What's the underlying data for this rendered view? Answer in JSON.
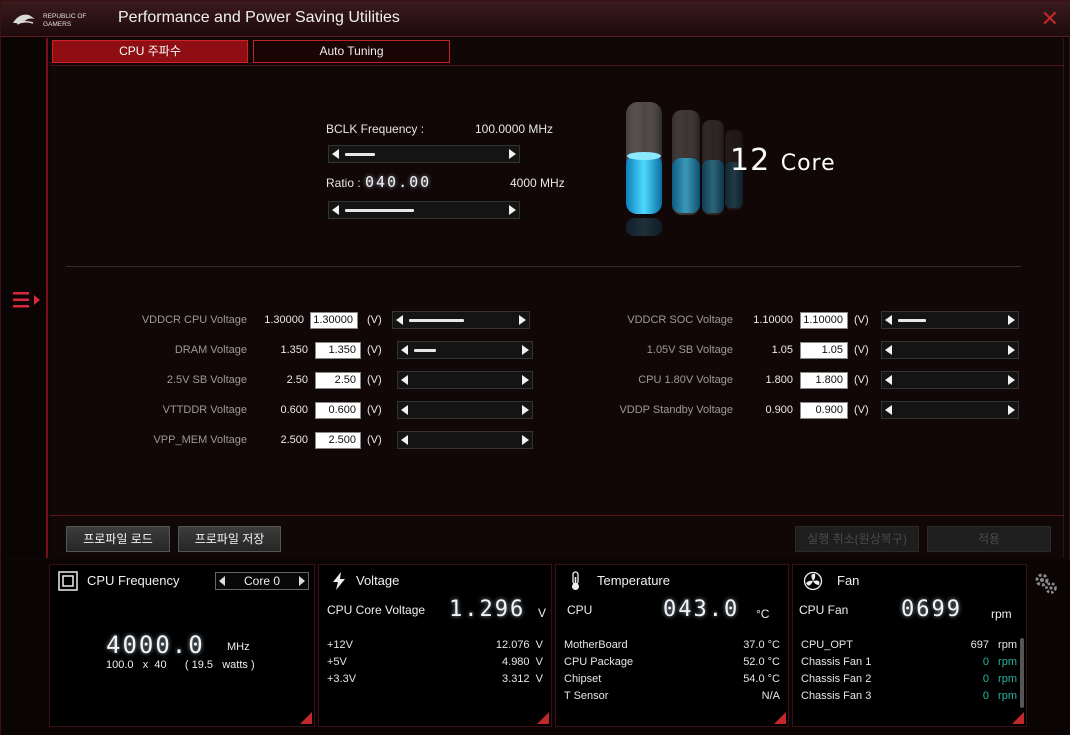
{
  "window": {
    "title": "Performance and Power Saving Utilities"
  },
  "tabs": [
    {
      "label": "CPU 주파수",
      "active": true
    },
    {
      "label": "Auto Tuning",
      "active": false
    }
  ],
  "cpu_freq": {
    "bclk_label": "BCLK Frequency :",
    "bclk_value": "100.0000 MHz",
    "bclk_slider_position": 0.18,
    "ratio_label": "Ratio :",
    "ratio_value": "040.00",
    "ratio_freq": "4000 MHz",
    "ratio_slider_position": 0.42,
    "core_count": "12",
    "core_unit": "Core"
  },
  "voltages_left": [
    {
      "name": "VDDCR CPU Voltage",
      "value": "1.30000",
      "input": "1.30000",
      "unit": "(V)",
      "slider_position": 0.5
    },
    {
      "name": "DRAM Voltage",
      "value": "1.350",
      "input": "1.350",
      "unit": "(V)",
      "slider_position": 0.2
    },
    {
      "name": "2.5V SB Voltage",
      "value": "2.50",
      "input": "2.50",
      "unit": "(V)",
      "slider_position": 0
    },
    {
      "name": "VTTDDR Voltage",
      "value": "0.600",
      "input": "0.600",
      "unit": "(V)",
      "slider_position": 0
    },
    {
      "name": "VPP_MEM Voltage",
      "value": "2.500",
      "input": "2.500",
      "unit": "(V)",
      "slider_position": 0
    }
  ],
  "voltages_right": [
    {
      "name": "VDDCR SOC Voltage",
      "value": "1.10000",
      "input": "1.10000",
      "unit": "(V)",
      "slider_position": 0.25
    },
    {
      "name": "1.05V SB Voltage",
      "value": "1.05",
      "input": "1.05",
      "unit": "(V)",
      "slider_position": 0
    },
    {
      "name": "CPU 1.80V Voltage",
      "value": "1.800",
      "input": "1.800",
      "unit": "(V)",
      "slider_position": 0
    },
    {
      "name": "VDDP Standby Voltage",
      "value": "0.900",
      "input": "0.900",
      "unit": "(V)",
      "slider_position": 0
    }
  ],
  "buttons": {
    "load_profile": "프로파일 로드",
    "save_profile": "프로파일 저장",
    "undo": "실행 취소(원상복구)",
    "apply": "적용"
  },
  "monitor": {
    "cpu_frequency": {
      "title": "CPU Frequency",
      "core_select": "Core 0",
      "value": "4000.0",
      "unit": "MHz",
      "bclk": "100.0",
      "times": "x",
      "ratio": "40",
      "watts": "( 19.5   watts )"
    },
    "voltage": {
      "title": "Voltage",
      "main_label": "CPU Core Voltage",
      "main_value": "1.296",
      "main_unit": "V",
      "rows": [
        {
          "k": "+12V",
          "v": "12.076  V"
        },
        {
          "k": "+5V",
          "v": "4.980  V"
        },
        {
          "k": "+3.3V",
          "v": "3.312  V"
        }
      ]
    },
    "temperature": {
      "title": "Temperature",
      "main_label": "CPU",
      "main_value": "043.0",
      "main_unit": "°C",
      "rows": [
        {
          "k": "MotherBoard",
          "v": "37.0 °C"
        },
        {
          "k": "CPU Package",
          "v": "52.0 °C"
        },
        {
          "k": "Chipset",
          "v": "54.0 °C"
        },
        {
          "k": "T Sensor",
          "v": "N/A"
        }
      ]
    },
    "fan": {
      "title": "Fan",
      "main_label": "CPU Fan",
      "main_value": "0699",
      "main_unit": "rpm",
      "rows": [
        {
          "k": "CPU_OPT",
          "v": "697",
          "u": "rpm"
        },
        {
          "k": "Chassis Fan 1",
          "v": "0",
          "u": "rpm"
        },
        {
          "k": "Chassis Fan 2",
          "v": "0",
          "u": "rpm"
        },
        {
          "k": "Chassis Fan 3",
          "v": "0",
          "u": "rpm"
        }
      ]
    }
  },
  "colors": {
    "accent": "#c0282c",
    "tab_active": "#8e0e14",
    "liquid": "#1ab8e8",
    "fan_zero": "#27b3a0"
  },
  "icons": [
    "rog-logo",
    "close-icon",
    "menu-toggle-icon",
    "cpu-chip-icon",
    "lightning-icon",
    "thermometer-icon",
    "fan-icon",
    "gear-icon"
  ]
}
